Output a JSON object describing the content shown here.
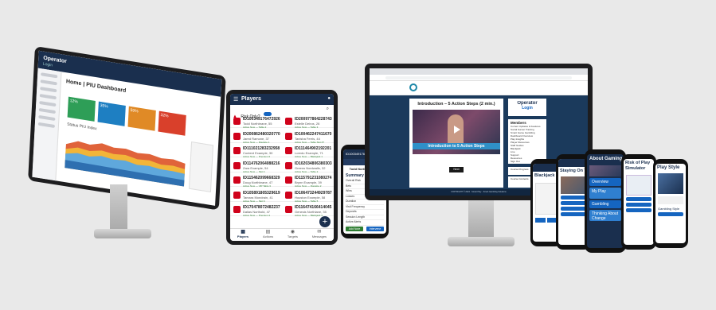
{
  "colors": {
    "navy": "#1a2f4e",
    "blue": "#1565c0",
    "red": "#d0021b",
    "green": "#2e7d32",
    "orange": "#f0a030",
    "teal": "#1e88a8"
  },
  "dashboard": {
    "app_name": "Operator",
    "app_sub": "Login",
    "title": "Home | PIU Dashboard",
    "kpis": [
      {
        "value": "12%",
        "color": "#2e9e57"
      },
      {
        "value": "35%",
        "color": "#1e7fc2"
      },
      {
        "value": "59%",
        "color": "#e08a26"
      },
      {
        "value": "32%",
        "color": "#d9402b"
      }
    ],
    "chart_title": "Status PIU Index"
  },
  "tablet": {
    "title": "Players",
    "filter_label": "Risk Only?",
    "nav": [
      "Players",
      "Actions",
      "Targets",
      "Messages"
    ],
    "players": [
      {
        "id": "ID100349176472926",
        "name": "Todd Northbrane, 55",
        "status": "Active Now",
        "place": "Table 2"
      },
      {
        "id": "ID200977864228743",
        "name": "Estelle Deiros, 26",
        "status": "Active Now",
        "place": "Table 3"
      },
      {
        "id": "ID200862480320770",
        "name": "Jared Ramone, 37",
        "status": "Active Now",
        "place": "Roulette 1"
      },
      {
        "id": "ID100462247411670",
        "name": "Tanisha Ferris, 44",
        "status": "Active Now",
        "place": "Table Slot #7"
      },
      {
        "id": "ID111021283232958",
        "name": "Content Example, 30",
        "status": "Active Now",
        "place": "Premium 6"
      },
      {
        "id": "ID111464902192201",
        "name": "Loredo Example, 71",
        "status": "Active Now",
        "place": "Blackjack 1"
      },
      {
        "id": "ID114762064088216",
        "name": "Zara Example, 54",
        "status": "Active Now",
        "place": "Slot 4"
      },
      {
        "id": "ID102034806380303",
        "name": "Greens Nordwalls, 32",
        "status": "Active Now",
        "place": "Table 2"
      },
      {
        "id": "ID115462099668329",
        "name": "Doug Northbrane, 47",
        "status": "Active Now",
        "place": "VIP Table 3"
      },
      {
        "id": "ID115791231080274",
        "name": "Brynn Example, 39",
        "status": "Active Now",
        "place": "Roulette 2"
      },
      {
        "id": "ID105891805329619",
        "name": "Tamara Mondrain, 41",
        "status": "Active Now",
        "place": "Slot 9"
      },
      {
        "id": "ID106473244929787",
        "name": "Houston Example, 58",
        "status": "Active Now",
        "place": "Table 5"
      },
      {
        "id": "ID170478072482237",
        "name": "Dallas Northold, 47",
        "status": "Active Now",
        "place": "Premium 2"
      },
      {
        "id": "ID116474166414045",
        "name": "Genesis Northlane, 35",
        "status": "Active Now",
        "place": "Blackjack 3"
      }
    ]
  },
  "phone_mid": {
    "header": "ID100349176472926",
    "name": "Todd Northbrane, 55",
    "section": "Summary",
    "rows": [
      "Overall Risk",
      "Bets",
      "Wins",
      "Losses",
      "Duration",
      "Visit Frequency",
      "Deposits",
      "Session Length",
      "Active Alerts"
    ],
    "buttons": [
      "Add Note",
      "Intervene"
    ]
  },
  "course": {
    "video_title": "Introduction – 5 Action Steps (2 min.)",
    "video_caption": "Introduction to 5 Action Steps",
    "operator": "Operator",
    "login": "Login",
    "members_title": "Members",
    "members": [
      "Current Updates & Features",
      "Social Gamer Training",
      "Smart Game Gambling",
      "Dashboard Overview",
      "Play Insights",
      "Player Resources",
      "Staff Guides",
      "Blackjack",
      "Live",
      "Support",
      "Resources",
      "Sign Out"
    ],
    "next_btn": "Next",
    "progress_label": "Course Progress",
    "contents_label": "Course Contents",
    "footer": "COPYRIGHT © 2024 · Smart Play · Smart Gambling Solutions"
  },
  "phones_right": [
    {
      "title": "Blackjack Ba"
    },
    {
      "title": "Staying On Tra"
    },
    {
      "title": "About Gaming",
      "items": [
        "Overview",
        "My Play",
        "Gambling",
        "Thinking About Change"
      ]
    },
    {
      "title": "Risk of Play Simulator"
    },
    {
      "title": "Play Style",
      "sub": "Gambling Style"
    }
  ]
}
